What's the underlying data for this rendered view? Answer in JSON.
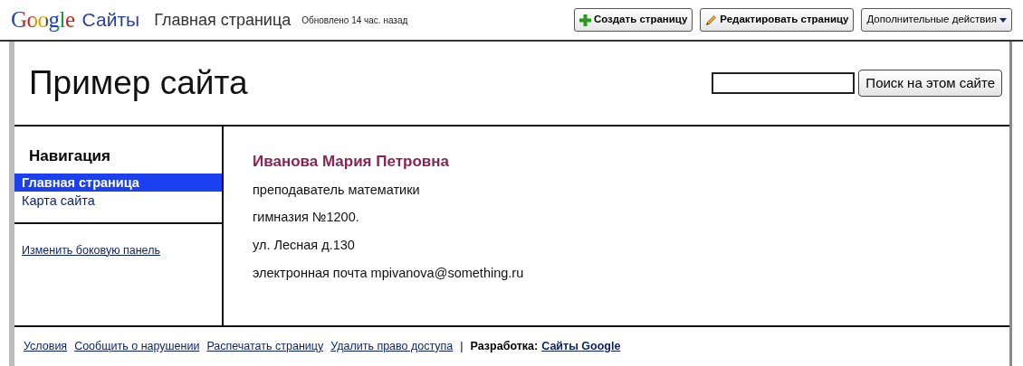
{
  "topbar": {
    "logo": "Google",
    "product": "Сайты",
    "page_title": "Главная страница",
    "updated": "Обновлено 14 час. назад",
    "buttons": [
      {
        "label": "Создать страницу",
        "kind": "create"
      },
      {
        "label": "Редактировать страницу",
        "kind": "edit"
      },
      {
        "label": "Дополнительные действия",
        "kind": "menu"
      }
    ]
  },
  "site": {
    "title": "Пример сайта",
    "search": {
      "button": "Поиск на этом сайте"
    }
  },
  "sidebar": {
    "heading": "Навигация",
    "items": [
      {
        "label": "Главная страница",
        "selected": true
      },
      {
        "label": "Карта сайта",
        "selected": false
      }
    ],
    "edit_link": "Изменить боковую панель"
  },
  "content": {
    "name": "Иванова Мария Петровна",
    "lines": [
      "преподаватель математики",
      "гимназия №1200.",
      "ул. Лесная д.130",
      "электронная почта mpivanova@something.ru"
    ]
  },
  "footer": {
    "links": [
      "Условия",
      "Сообщить о нарушении",
      "Распечатать страницу",
      "Удалить право доступа"
    ],
    "separator": "|",
    "credit_label": "Разработка:",
    "credit_link": "Сайты Google"
  }
}
